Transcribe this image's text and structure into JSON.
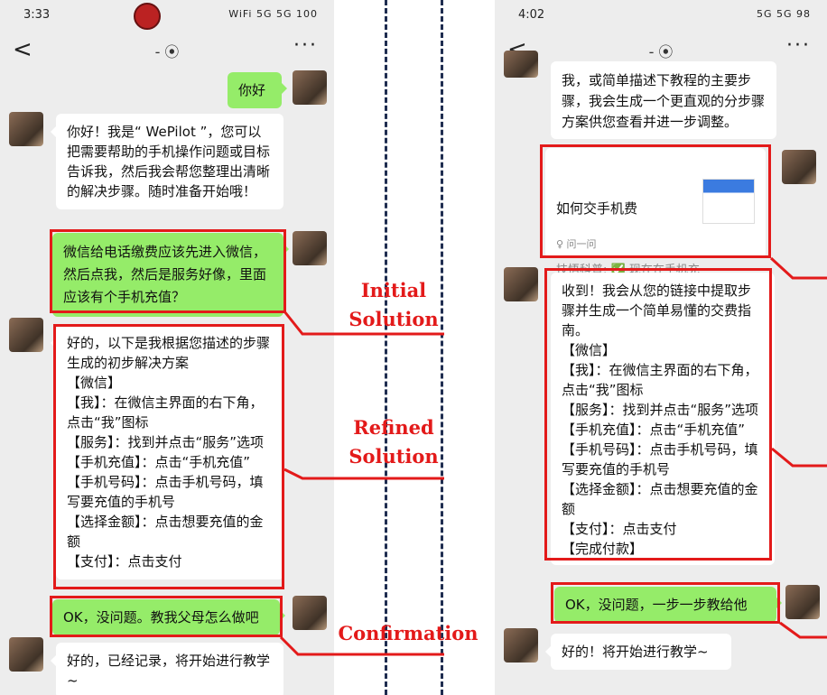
{
  "left_phone": {
    "status_time": "3:33",
    "status_icons": "WiFi 5G 5G 100",
    "nav": {
      "back": "<",
      "title": "- ⦿",
      "more": "···"
    },
    "messages": [
      {
        "from": "user",
        "text": "你好"
      },
      {
        "from": "bot",
        "text": "你好！我是“ WePilot ”，您可以把需要帮助的手机操作问题或目标告诉我，然后我会帮您整理出清晰的解决步骤。随时准备开始哦！"
      },
      {
        "from": "user",
        "text": "微信给电话缴费应该先进入微信，然后点我，然后是服务好像，里面应该有个手机充值？"
      },
      {
        "from": "bot",
        "text": "好的，以下是我根据您描述的步骤生成的初步解决方案\n【微信】\n【我】：在微信主界面的右下角，点击“我”图标\n【服务】：找到并点击“服务”选项\n【手机充值】：点击“手机充值”\n【手机号码】：点击手机号码，填写要充值的手机号\n【选择金额】：点击想要充值的金额\n【支付】：点击支付"
      },
      {
        "from": "user",
        "text": "OK，没问题。教我父母怎么做吧"
      },
      {
        "from": "bot",
        "text": "好的，已经记录，将开始进行教学~"
      }
    ]
  },
  "right_phone": {
    "status_time": "4:02",
    "status_icons": "5G 5G 98",
    "nav": {
      "back": "<",
      "title": "- ⦿",
      "more": "···"
    },
    "messages": [
      {
        "from": "bot",
        "text": "我，或简单描述下教程的主要步骤，我会生成一个更直观的分步骤方案供您查看并进一步调整。"
      },
      {
        "from": "user",
        "type": "link_card",
        "title": "如何交手机费",
        "body": "技悟科普: ✅ 现在在手机充值是很简单的，可以根据手机所属的运营商，通过移…",
        "footer": "♀ 问一问"
      },
      {
        "from": "bot",
        "text": "收到！我会从您的链接中提取步骤并生成一个简单易懂的交费指南。\n【微信】\n【我】：在微信主界面的右下角，点击“我”图标\n【服务】：找到并点击“服务”选项\n【手机充值】：点击“手机充值”\n【手机号码】：点击手机号码，填写要充值的手机号\n【选择金额】：点击想要充值的金额\n【支付】：点击支付\n【完成付款】"
      },
      {
        "from": "user",
        "text": "OK，没问题，一步一步教给他"
      },
      {
        "from": "bot",
        "text": "好的！将开始进行教学~"
      }
    ]
  },
  "labels": {
    "initial": "Initial\nSolution",
    "refined": "Refined\nSolution",
    "confirmation": "Confirmation"
  },
  "colors": {
    "highlight": "#e31a1a",
    "user_bubble": "#95ec69",
    "divider": "#1f2d50"
  }
}
